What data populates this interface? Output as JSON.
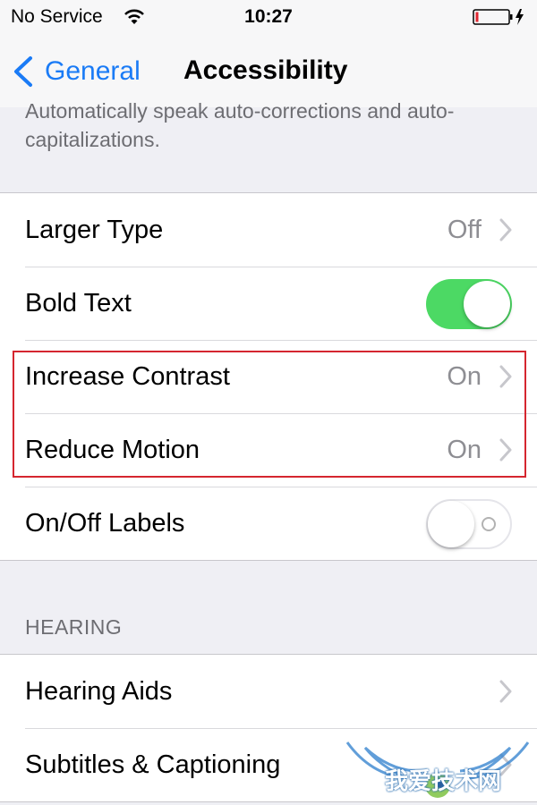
{
  "status_bar": {
    "carrier": "No Service",
    "time": "10:27",
    "icons": [
      "wifi-icon",
      "battery-icon"
    ]
  },
  "nav": {
    "back_label": "General",
    "title": "Accessibility"
  },
  "footer_note": "Automatically speak auto-corrections and auto-capitalizations.",
  "settings": {
    "larger_type": {
      "label": "Larger Type",
      "value": "Off"
    },
    "bold_text": {
      "label": "Bold Text",
      "toggle_on": true
    },
    "increase_contrast": {
      "label": "Increase Contrast",
      "value": "On"
    },
    "reduce_motion": {
      "label": "Reduce Motion",
      "value": "On"
    },
    "onoff_labels": {
      "label": "On/Off Labels",
      "toggle_on": false
    }
  },
  "hearing": {
    "header": "HEARING",
    "hearing_aids": {
      "label": "Hearing Aids"
    },
    "subtitles": {
      "label": "Subtitles & Captioning"
    }
  },
  "watermark": {
    "text": "我爱技术网"
  },
  "colors": {
    "accent": "#1a7bf6",
    "toggle_on": "#4cd964",
    "highlight": "#d5262f",
    "background": "#efeff4"
  }
}
